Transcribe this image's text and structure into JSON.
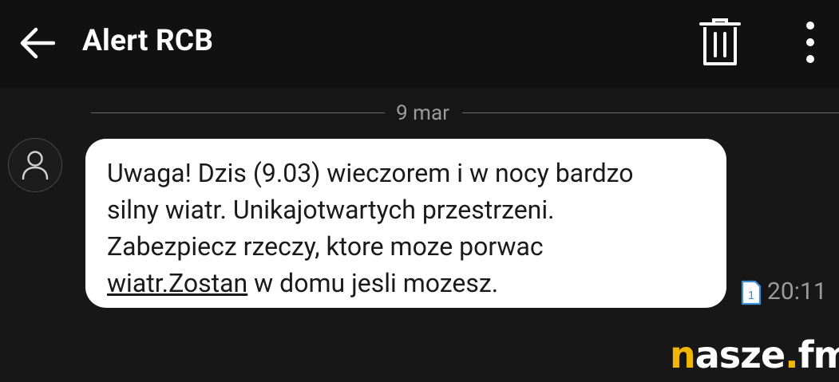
{
  "header": {
    "title": "Alert RCB",
    "back_icon": "arrow-left-icon",
    "delete_icon": "trash-icon",
    "menu_icon": "more-vertical-icon"
  },
  "conversation": {
    "date_divider": "9 mar",
    "message": {
      "lines": [
        "Uwaga! Dzis (9.03) wieczorem i w nocy bardzo",
        "silny wiatr. Unikajotwartych przestrzeni.",
        "Zabezpiecz rzeczy, ktore moze porwac"
      ],
      "last_line_link": "wiatr.Zostan",
      "last_line_rest": " w domu jesli mozesz.",
      "time": "20:11",
      "sim_badge": "1"
    }
  },
  "watermark": {
    "first_letter": "n",
    "middle": "asze",
    "dot": ".",
    "suffix": "fm"
  },
  "colors": {
    "background": "#171717",
    "topbar": "#111111",
    "bubble": "#ffffff",
    "sim_badge": "#3d8fd6",
    "watermark_accent": "#f3b600"
  }
}
